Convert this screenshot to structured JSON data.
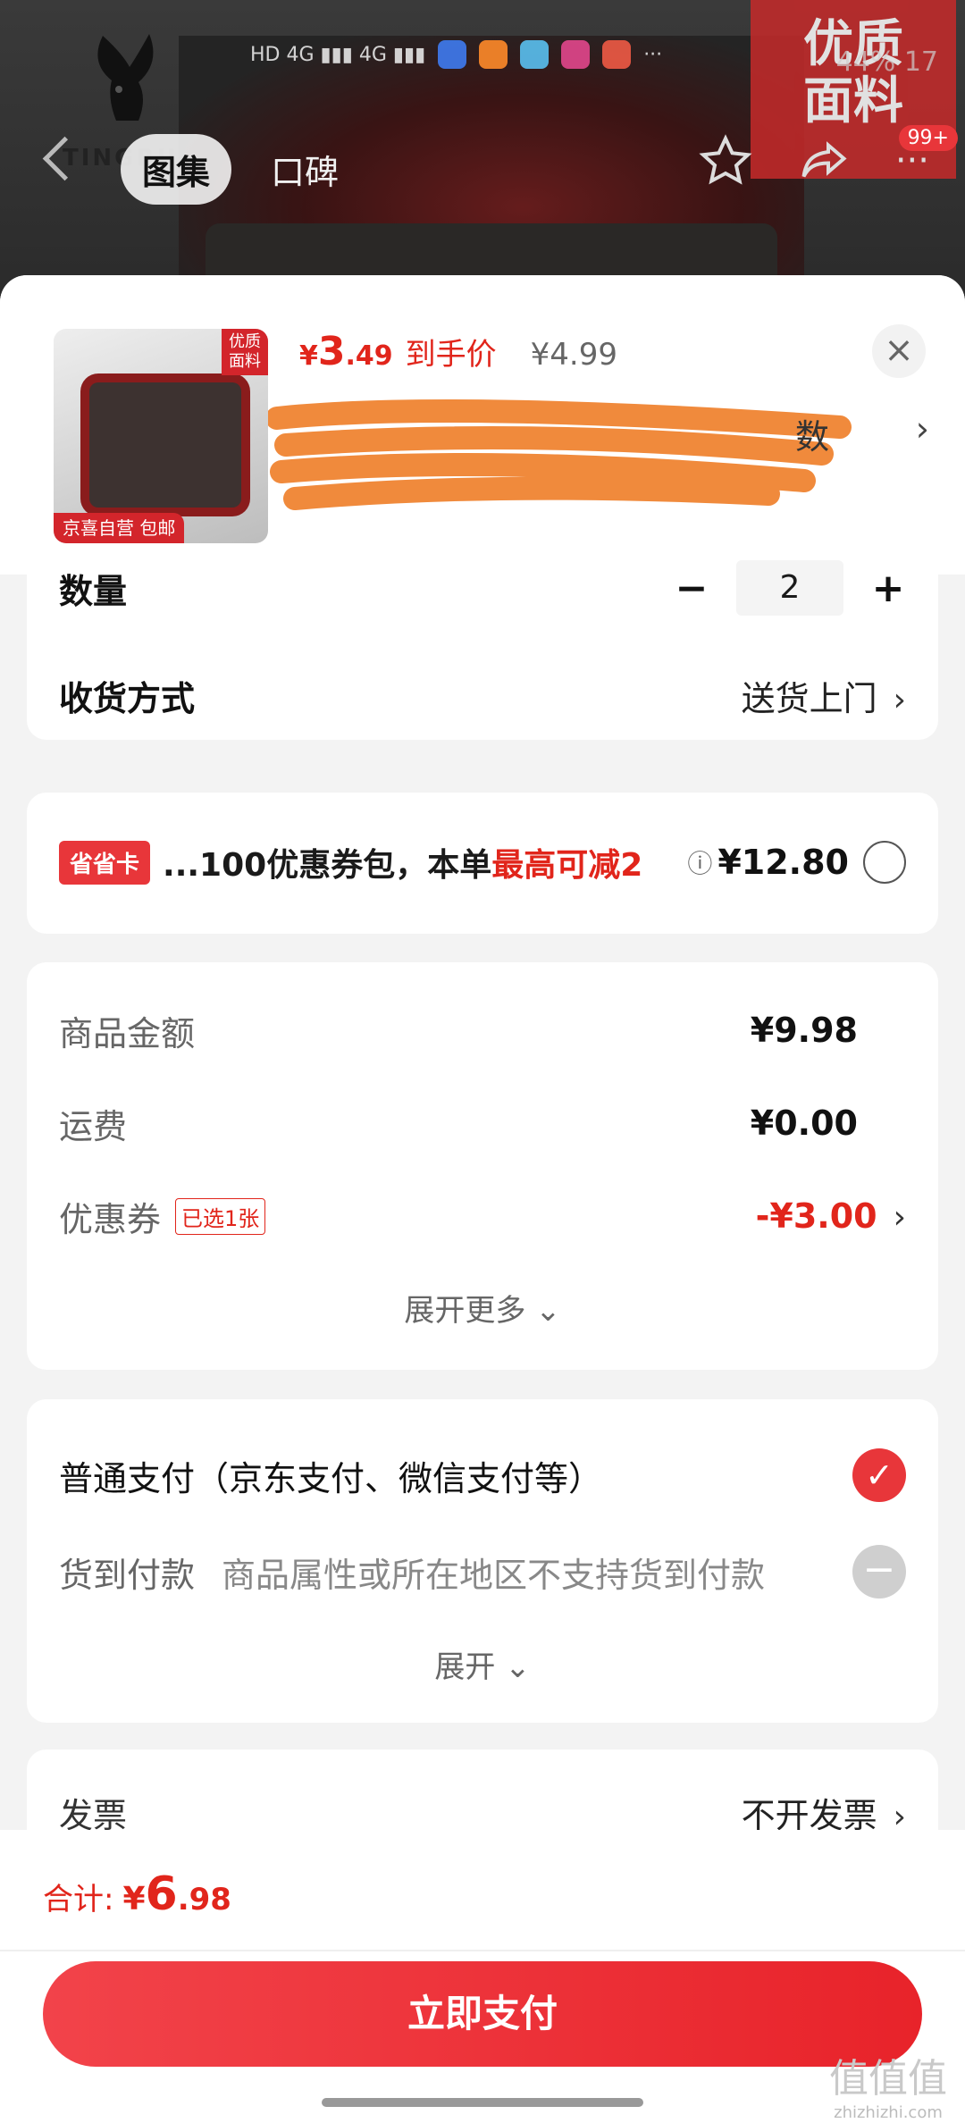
{
  "background": {
    "brand": "TINGRUI",
    "promo_tag": "优质\n面料",
    "tabs": [
      "图集",
      "口碑"
    ],
    "notification_count": "99+",
    "status_text": "44% 17"
  },
  "product": {
    "thumb_tag": "优质面料",
    "thumb_foot": "京喜自营 包邮",
    "price_int": "3",
    "price_dec": ".49",
    "price_symbol": "¥",
    "price_label": "到手价",
    "original_price": "¥4.99",
    "spec_tail": "数"
  },
  "quantity": {
    "label": "数量",
    "value": "2",
    "minus": "−",
    "plus": "+"
  },
  "delivery": {
    "label": "收货方式",
    "value": "送货上门"
  },
  "savecard": {
    "badge": "省省卡",
    "text_a": "...100优惠券包，本单",
    "text_b": "最高可减2",
    "price": "¥12.80"
  },
  "summary": {
    "items": [
      {
        "label": "商品金额",
        "value": "¥9.98"
      },
      {
        "label": "运费",
        "value": "¥0.00"
      },
      {
        "label": "优惠券",
        "tag": "已选1张",
        "value": "-¥3.00"
      }
    ],
    "expand": "展开更多"
  },
  "payment": {
    "normal": "普通支付（京东支付、微信支付等）",
    "cod_label": "货到付款",
    "cod_note": "商品属性或所在地区不支持货到付款",
    "expand": "展开"
  },
  "invoice": {
    "label": "发票",
    "value": "不开发票"
  },
  "footer": {
    "total_label": "合计:",
    "total_symbol": "¥",
    "total_int": "6",
    "total_dec": ".98",
    "pay_button": "立即支付"
  },
  "watermark": {
    "main": "值值值",
    "sub": "zhizhizhi.com"
  },
  "colors": {
    "accent": "#e1251b",
    "button": "#ee2d32"
  }
}
